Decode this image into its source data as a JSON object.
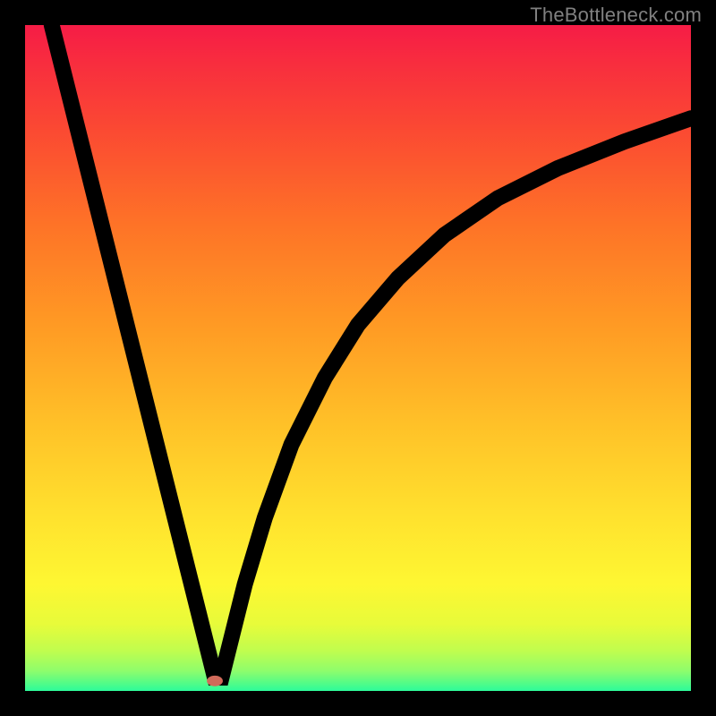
{
  "watermark": {
    "text": "TheBottleneck.com"
  },
  "chart_data": {
    "type": "line",
    "title": "",
    "xlabel": "",
    "ylabel": "",
    "xlim": [
      0,
      100
    ],
    "ylim": [
      0,
      100
    ],
    "grid": false,
    "legend": false,
    "series": [
      {
        "name": "curve",
        "x": [
          4,
          6,
          8,
          10,
          12,
          14,
          16,
          18,
          20,
          22,
          24,
          26,
          27.5,
          28.5,
          29.5,
          31,
          33,
          36,
          40,
          45,
          50,
          56,
          63,
          71,
          80,
          90,
          100
        ],
        "y": [
          100,
          92,
          84,
          76,
          68,
          60,
          52,
          44,
          36,
          28,
          20,
          12,
          6,
          2,
          2,
          8,
          16,
          26,
          37,
          47,
          55,
          62,
          68.5,
          74,
          78.5,
          82.5,
          86
        ]
      }
    ],
    "marker": {
      "x": 28.5,
      "y": 1.5,
      "rx": 1.2,
      "ry": 0.8,
      "color": "#d06a5a"
    },
    "background_gradient": {
      "stops": [
        {
          "pos": 0,
          "color": "#f61c46"
        },
        {
          "pos": 6,
          "color": "#f82e3e"
        },
        {
          "pos": 16,
          "color": "#fb4a32"
        },
        {
          "pos": 30,
          "color": "#fe7327"
        },
        {
          "pos": 45,
          "color": "#ff9a24"
        },
        {
          "pos": 60,
          "color": "#ffc128"
        },
        {
          "pos": 74,
          "color": "#ffe22e"
        },
        {
          "pos": 84,
          "color": "#fef732"
        },
        {
          "pos": 90,
          "color": "#e7fb3a"
        },
        {
          "pos": 94,
          "color": "#c0fd4e"
        },
        {
          "pos": 97,
          "color": "#8efd6c"
        },
        {
          "pos": 100,
          "color": "#2dfb9a"
        }
      ]
    }
  }
}
